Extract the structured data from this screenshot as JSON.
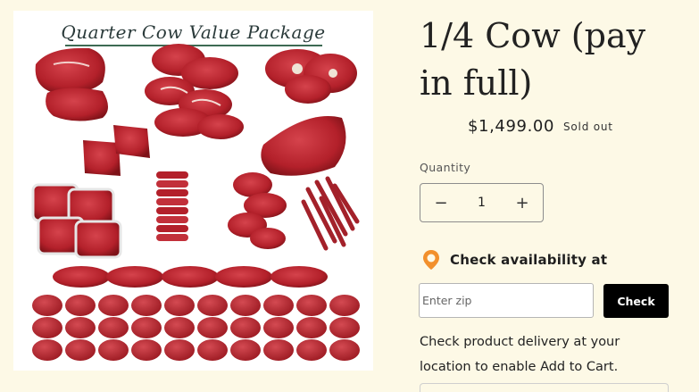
{
  "product": {
    "image_title": "Quarter Cow Value Package",
    "title": "1/4 Cow (pay in full)",
    "price": "$1,499.00",
    "status_badge": "Sold out"
  },
  "quantity": {
    "label": "Quantity",
    "value": "1",
    "decrease_label": "−",
    "increase_label": "+"
  },
  "availability": {
    "icon": "location-pin-icon",
    "label": "Check availability at",
    "zip_placeholder": "Enter zip",
    "check_label": "Check",
    "note": "Check product delivery at your location to enable Add to Cart."
  },
  "colors": {
    "background": "#fdf9e6",
    "meat": "#b3202a",
    "pin": "#f2902c",
    "button": "#000000"
  }
}
